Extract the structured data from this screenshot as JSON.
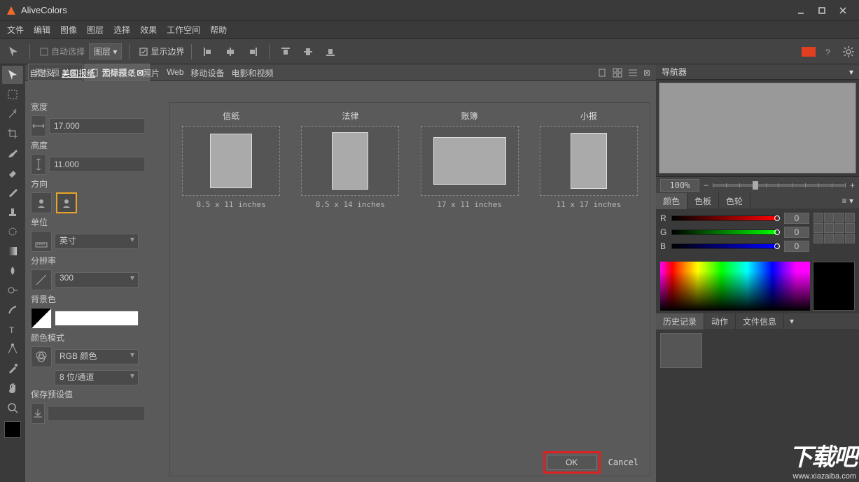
{
  "app": {
    "title": "AliveColors"
  },
  "menu": [
    "文件",
    "编辑",
    "图像",
    "图层",
    "选择",
    "效果",
    "工作空间",
    "帮助"
  ],
  "toolbar": {
    "auto_select": "自动选择",
    "layer_sel": "图层",
    "show_bounds": "显示边界"
  },
  "tabs": [
    {
      "label": "无标题 1",
      "active": false
    },
    {
      "label": "无标题 2",
      "active": true
    }
  ],
  "newdoc": {
    "categories": [
      "自定义",
      "美国报纸",
      "国际报纸",
      "照片",
      "Web",
      "移动设备",
      "电影和视频"
    ],
    "active_category": "美国报纸",
    "width_label": "宽度",
    "width_value": "17.000",
    "height_label": "高度",
    "height_value": "11.000",
    "orientation_label": "方向",
    "units_label": "单位",
    "units_value": "英寸",
    "resolution_label": "分辨率",
    "resolution_value": "300",
    "bg_label": "背景色",
    "colormode_label": "颜色模式",
    "colormode_value": "RGB 颜色",
    "bitdepth_value": "8 位/通道",
    "preset_label": "保存预设值",
    "presets": [
      {
        "name": "信纸",
        "size": "8.5 x 11 inches",
        "w": 60,
        "h": 78
      },
      {
        "name": "法律",
        "size": "8.5 x 14 inches",
        "w": 52,
        "h": 82
      },
      {
        "name": "账簿",
        "size": "17 x 11 inches",
        "w": 104,
        "h": 68
      },
      {
        "name": "小报",
        "size": "11 x 17 inches",
        "w": 52,
        "h": 80
      }
    ],
    "ok": "OK",
    "cancel": "Cancel"
  },
  "right": {
    "nav_title": "导航器",
    "zoom_value": "100%",
    "zoom_minus": "−",
    "zoom_plus": "+",
    "color_tabs": [
      "颜色",
      "色板",
      "色轮"
    ],
    "rgb": {
      "R": "0",
      "G": "0",
      "B": "0"
    },
    "hist_tabs": [
      "历史记录",
      "动作",
      "文件信息"
    ]
  },
  "watermark": {
    "big": "下载吧",
    "small": "www.xiazaiba.com"
  }
}
